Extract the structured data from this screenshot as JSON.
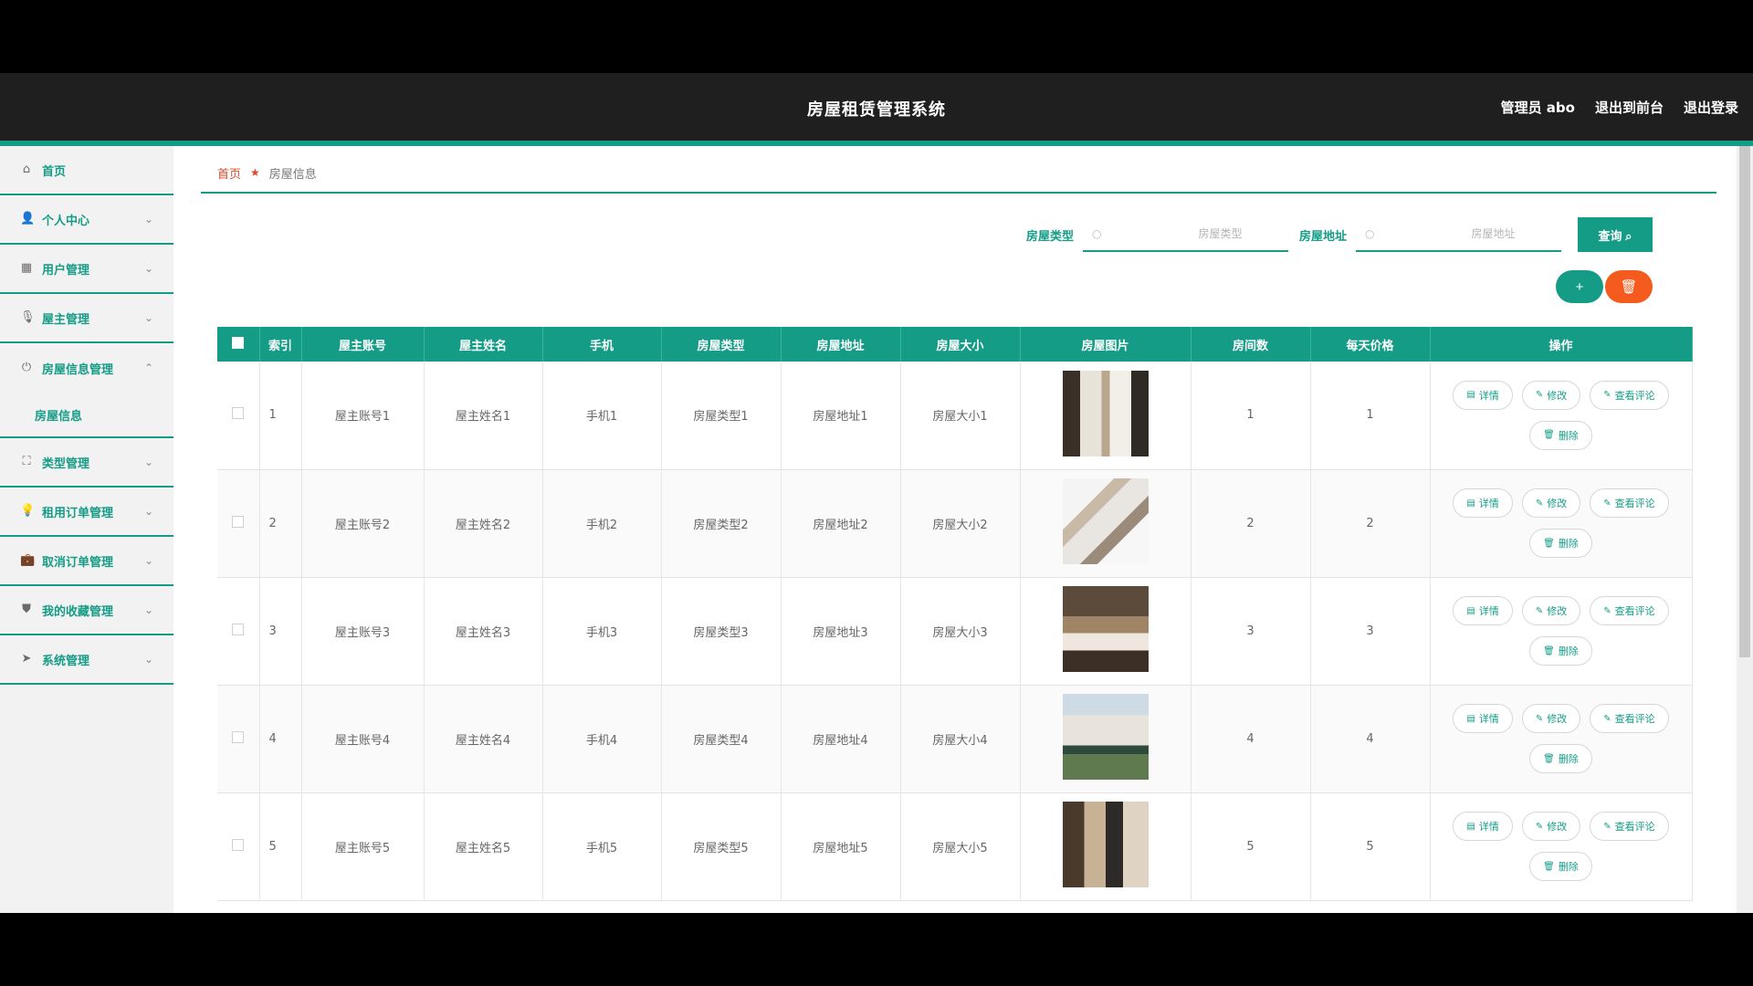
{
  "header": {
    "title": "房屋租赁管理系统",
    "admin": "管理员 abo",
    "to_front": "退出到前台",
    "logout": "退出登录"
  },
  "sidebar": {
    "items": [
      {
        "label": "首页",
        "icon": "home-icon",
        "glyph": "⌂"
      },
      {
        "label": "个人中心",
        "icon": "user-icon",
        "glyph": "👤"
      },
      {
        "label": "用户管理",
        "icon": "card-icon",
        "glyph": "▦"
      },
      {
        "label": "屋主管理",
        "icon": "mic-icon",
        "glyph": "🎙"
      },
      {
        "label": "房屋信息管理",
        "icon": "power-icon",
        "glyph": "⏻"
      },
      {
        "label": "类型管理",
        "icon": "expand-icon",
        "glyph": "⛶"
      },
      {
        "label": "租用订单管理",
        "icon": "bulb-icon",
        "glyph": "💡"
      },
      {
        "label": "取消订单管理",
        "icon": "briefcase-icon",
        "glyph": "💼"
      },
      {
        "label": "我的收藏管理",
        "icon": "badge-icon",
        "glyph": "⛊"
      },
      {
        "label": "系统管理",
        "icon": "send-icon",
        "glyph": "➤"
      }
    ],
    "submenu": {
      "label": "房屋信息"
    }
  },
  "breadcrumb": {
    "home": "首页",
    "current": "房屋信息"
  },
  "search": {
    "type_label": "房屋类型",
    "type_placeholder": "房屋类型",
    "address_label": "房屋地址",
    "address_placeholder": "房屋地址",
    "query_button": "查询 ⌕"
  },
  "actions": {
    "add": "+",
    "delete": "🗑"
  },
  "table": {
    "headers": [
      "索引",
      "屋主账号",
      "屋主姓名",
      "手机",
      "房屋类型",
      "房屋地址",
      "房屋大小",
      "房屋图片",
      "房间数",
      "每天价格",
      "操作"
    ],
    "ops": {
      "detail": "详情",
      "edit": "修改",
      "comments": "查看评论",
      "delete": "删除"
    },
    "rows": [
      {
        "index": "1",
        "account": "屋主账号1",
        "name": "屋主姓名1",
        "phone": "手机1",
        "type": "房屋类型1",
        "address": "房屋地址1",
        "size": "房屋大小1",
        "rooms": "1",
        "price": "1"
      },
      {
        "index": "2",
        "account": "屋主账号2",
        "name": "屋主姓名2",
        "phone": "手机2",
        "type": "房屋类型2",
        "address": "房屋地址2",
        "size": "房屋大小2",
        "rooms": "2",
        "price": "2"
      },
      {
        "index": "3",
        "account": "屋主账号3",
        "name": "屋主姓名3",
        "phone": "手机3",
        "type": "房屋类型3",
        "address": "房屋地址3",
        "size": "房屋大小3",
        "rooms": "3",
        "price": "3"
      },
      {
        "index": "4",
        "account": "屋主账号4",
        "name": "屋主姓名4",
        "phone": "手机4",
        "type": "房屋类型4",
        "address": "房屋地址4",
        "size": "房屋大小4",
        "rooms": "4",
        "price": "4"
      },
      {
        "index": "5",
        "account": "屋主账号5",
        "name": "屋主姓名5",
        "phone": "手机5",
        "type": "房屋类型5",
        "address": "房屋地址5",
        "size": "房屋大小5",
        "rooms": "5",
        "price": "5"
      }
    ]
  },
  "colors": {
    "accent": "#159c87",
    "danger": "#f55a1e",
    "header_bg": "#1f1f1f"
  }
}
